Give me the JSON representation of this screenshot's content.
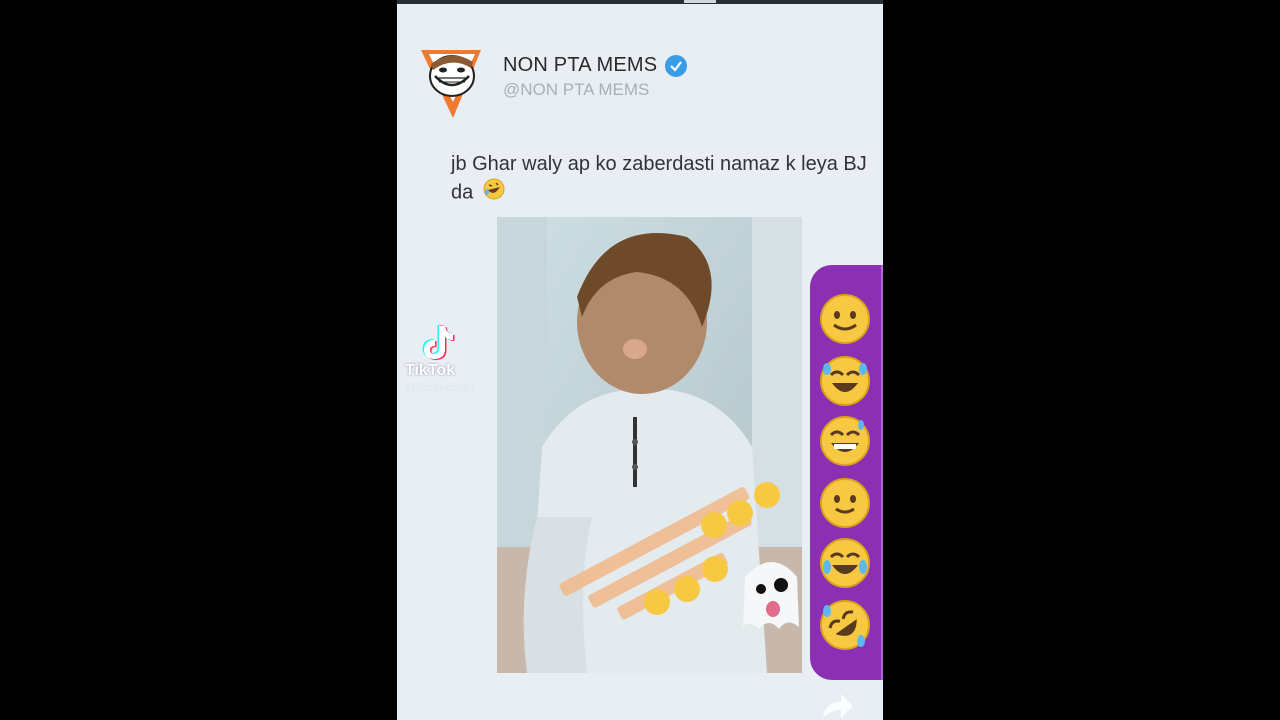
{
  "post": {
    "account_name": "NON PTA MEMS",
    "handle": "@NON PTA MEMS",
    "caption": "jb Ghar waly ap ko zaberdasti namaz k leya BJ da",
    "caption_emoji": "rolling-on-floor-laughing-icon"
  },
  "watermark": {
    "brand": "TikTok",
    "username": "@faizanch701"
  },
  "reactions": [
    {
      "icon": "slightly-smiling-face-icon"
    },
    {
      "icon": "joy-face-icon"
    },
    {
      "icon": "grinning-sweat-face-icon"
    },
    {
      "icon": "slightly-smiling-face-icon"
    },
    {
      "icon": "joy-face-icon"
    },
    {
      "icon": "rolling-on-floor-laughing-icon"
    }
  ],
  "colors": {
    "verified": "#3a9be6",
    "reaction_bar": "#8b2fb3",
    "background": "#e9eef4"
  }
}
